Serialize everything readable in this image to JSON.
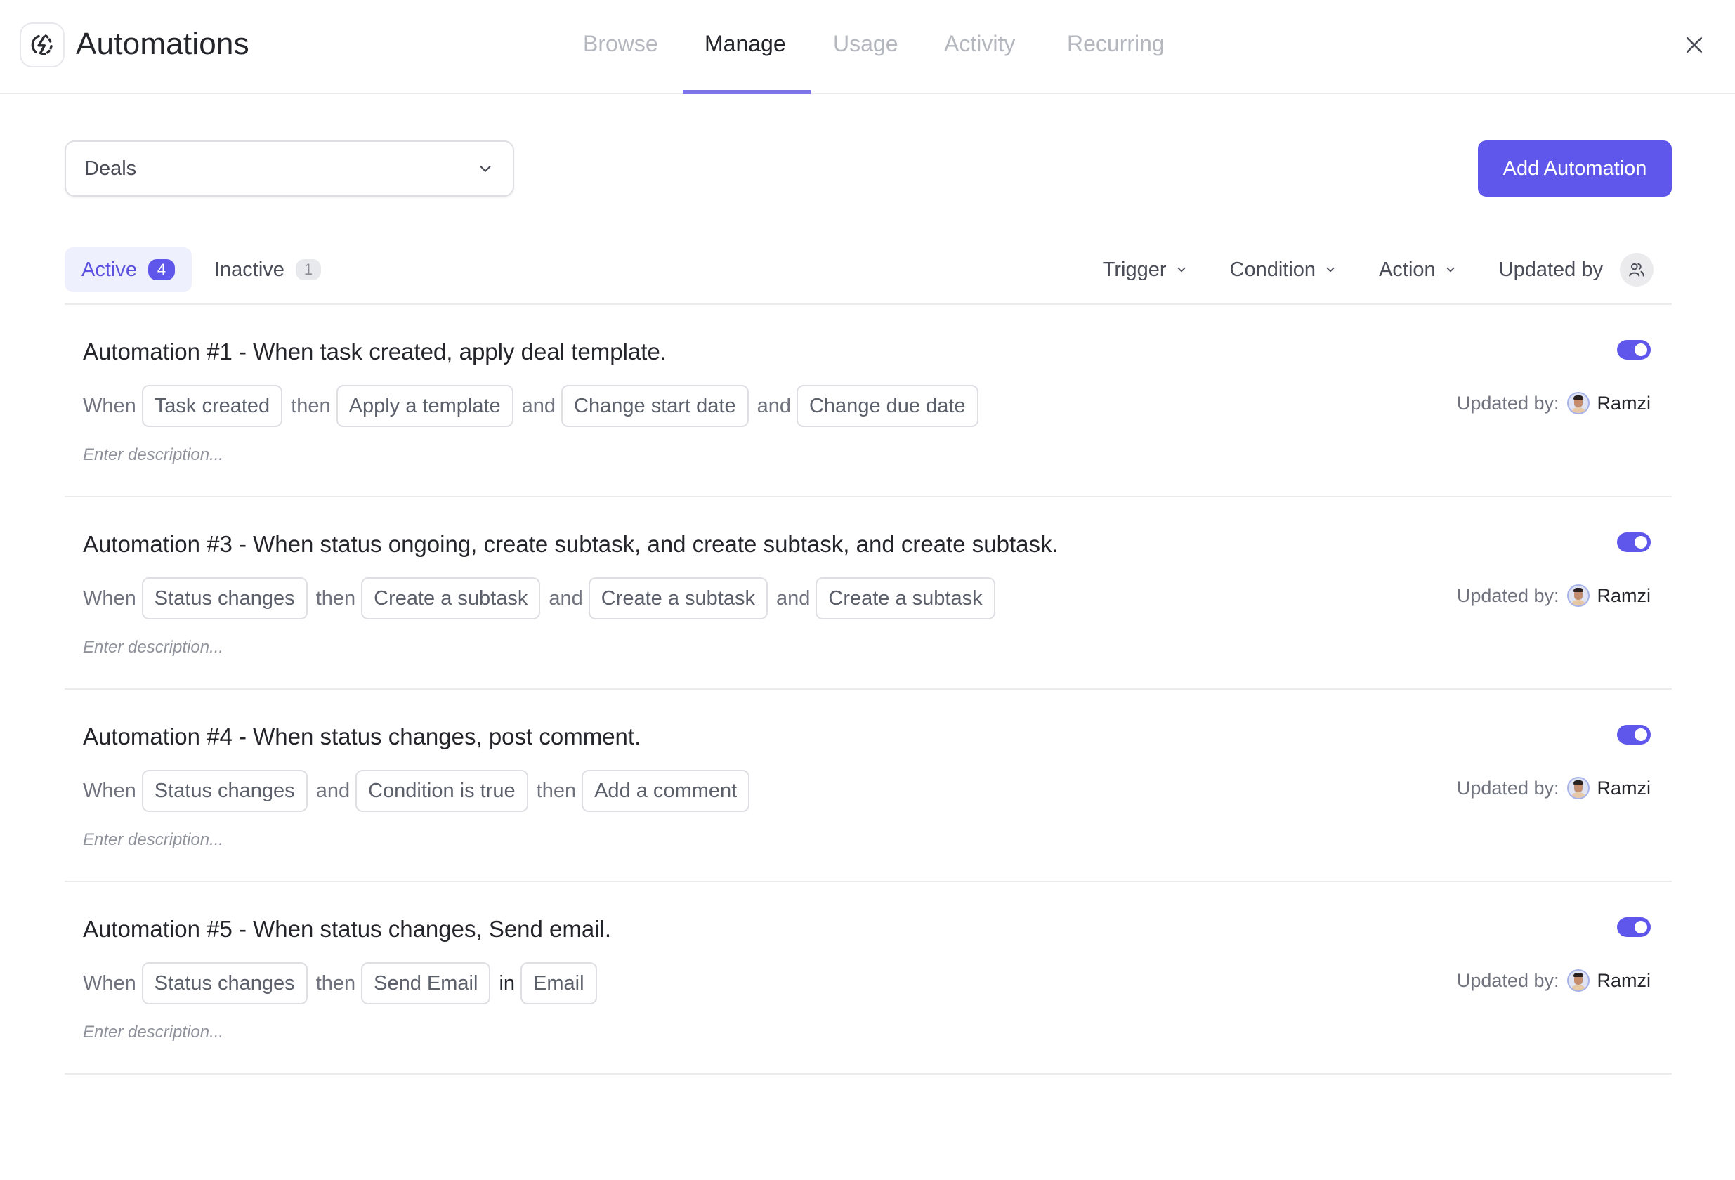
{
  "header": {
    "title": "Automations",
    "logo_icon": "automation-bolt-icon",
    "close_icon": "close-icon",
    "nav_tabs": [
      {
        "label": "Browse",
        "active": false
      },
      {
        "label": "Manage",
        "active": true
      },
      {
        "label": "Usage",
        "active": false
      },
      {
        "label": "Activity",
        "active": false
      },
      {
        "label": "Recurring",
        "active": false
      }
    ]
  },
  "toolbar": {
    "list_select": {
      "value": "Deals",
      "icon": "chevron-down-icon"
    },
    "add_button_label": "Add Automation"
  },
  "status_tabs": [
    {
      "label": "Active",
      "count": "4",
      "active": true
    },
    {
      "label": "Inactive",
      "count": "1",
      "active": false
    }
  ],
  "filters": {
    "trigger": "Trigger",
    "condition": "Condition",
    "action": "Action",
    "updated_by": "Updated by",
    "updated_by_icon": "people-icon"
  },
  "automations": [
    {
      "title": "Automation #1 - When task created, apply deal template.",
      "enabled": true,
      "when": "When",
      "trigger": "Task created",
      "connectors": [
        "then",
        "and",
        "and"
      ],
      "steps": [
        "Apply a template",
        "Change start date",
        "Change due date"
      ],
      "description_placeholder": "Enter description...",
      "updated_by_label": "Updated by:",
      "updated_by_name": "Ramzi"
    },
    {
      "title": "Automation #3 - When status ongoing, create subtask, and create subtask, and create subtask.",
      "enabled": true,
      "when": "When",
      "trigger": "Status changes",
      "connectors": [
        "then",
        "and",
        "and"
      ],
      "steps": [
        "Create a subtask",
        "Create a subtask",
        "Create a subtask"
      ],
      "description_placeholder": "Enter description...",
      "updated_by_label": "Updated by:",
      "updated_by_name": "Ramzi"
    },
    {
      "title": "Automation #4 - When status changes, post comment.",
      "enabled": true,
      "when": "When",
      "trigger": "Status changes",
      "connectors": [
        "and",
        "then"
      ],
      "steps": [
        "Condition is true",
        "Add a comment"
      ],
      "description_placeholder": "Enter description...",
      "updated_by_label": "Updated by:",
      "updated_by_name": "Ramzi"
    },
    {
      "title": "Automation #5 - When status changes, Send email.",
      "enabled": true,
      "when": "When",
      "trigger": "Status changes",
      "connectors": [
        "then",
        "in"
      ],
      "steps": [
        "Send Email",
        "Email"
      ],
      "description_placeholder": "Enter description...",
      "updated_by_label": "Updated by:",
      "updated_by_name": "Ramzi"
    }
  ],
  "colors": {
    "accent": "#5f57eb",
    "tab_underline": "#7c74e8",
    "active_tab_bg": "#eff0fd",
    "border": "#dedee3"
  }
}
